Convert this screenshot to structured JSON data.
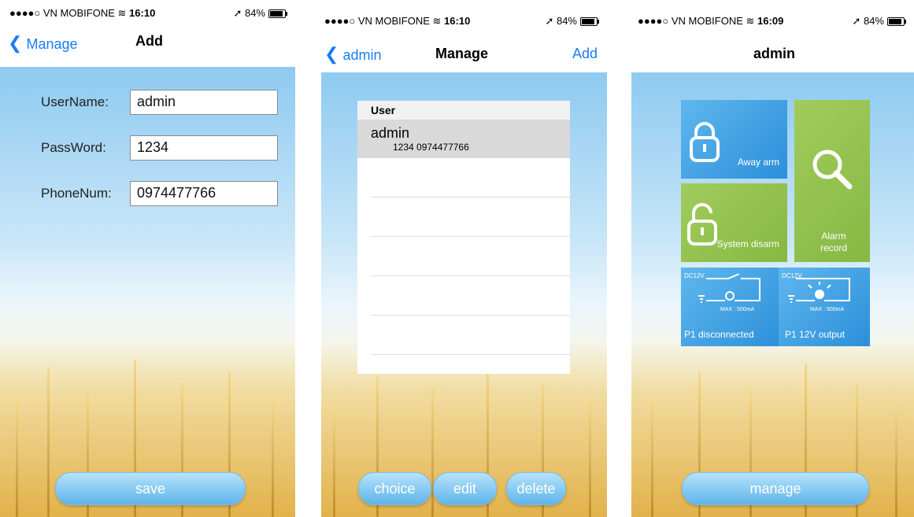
{
  "status_bar": {
    "carrier": "●●●●○ VN MOBIFONE",
    "battery": "84%",
    "arrow": "➚"
  },
  "screens": [
    {
      "time": "16:10",
      "nav": {
        "back_label": "Manage",
        "title": "Add"
      },
      "form": {
        "username_label": "UserName:",
        "username_value": "admin",
        "password_label": "PassWord:",
        "password_value": "1234",
        "phone_label": "PhoneNum:",
        "phone_value": "0974477766"
      },
      "save_label": "save"
    },
    {
      "time": "16:10",
      "nav": {
        "back_label": "admin",
        "title": "Manage",
        "action_label": "Add"
      },
      "list": {
        "header": "User",
        "selected": {
          "name": "admin",
          "details": "1234  0974477766"
        }
      },
      "buttons": {
        "choice": "choice",
        "edit": "edit",
        "delete": "delete"
      }
    },
    {
      "time": "16:09",
      "nav": {
        "title": "admin"
      },
      "tiles": {
        "away_arm": "Away arm",
        "system_disarm": "System disarm",
        "alarm_record": "Alarm record",
        "p1_disconnected": "P1 disconnected",
        "p1_12v_output": "P1 12V output",
        "dc12v": "DC12V",
        "max": "MAX : 500mA"
      },
      "manage_label": "manage"
    }
  ],
  "colors": {
    "link": "#1a7cf5",
    "tile_blue": "#2b8fd9",
    "tile_green": "#8bbb47"
  }
}
